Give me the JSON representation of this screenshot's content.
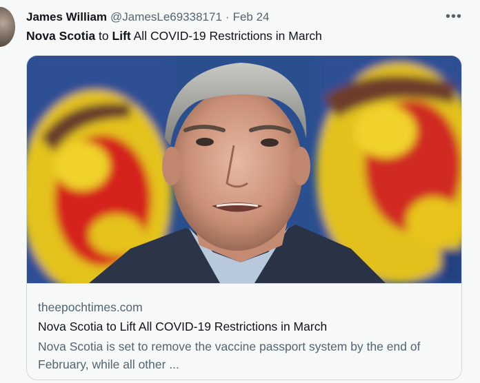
{
  "tweet": {
    "author_name": "James William",
    "author_handle": "@JamesLe69338171",
    "separator": "·",
    "date": "Feb 24",
    "more_icon": "more-horizontal-icon",
    "text_parts": {
      "bold_1": "Nova Scotia",
      "plain_1": " to ",
      "bold_2": "Lift",
      "plain_2": " All COVID-19 Restrictions in March"
    }
  },
  "card": {
    "image_alt": "Man in suit speaking in front of Nova Scotia flags",
    "domain": "theepochtimes.com",
    "title": "Nova Scotia to Lift All COVID-19 Restrictions in March",
    "description": "Nova Scotia is set to remove the vaccine passport system by the end of February, while all other ..."
  },
  "colors": {
    "background": "#f7f9f9",
    "border": "#cfd9de",
    "secondary_text": "#536471",
    "primary_text": "#0f1419"
  }
}
